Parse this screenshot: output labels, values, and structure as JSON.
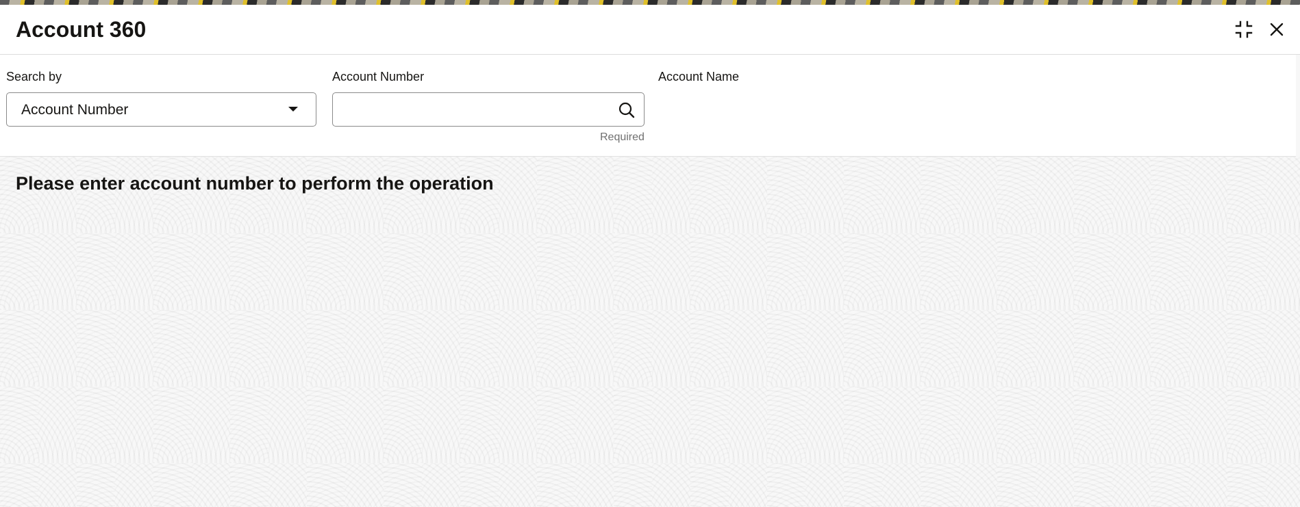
{
  "window": {
    "title": "Account 360"
  },
  "header": {
    "minimize_icon": "collapse-icon",
    "close_icon": "close-icon"
  },
  "form": {
    "search_by": {
      "label": "Search by",
      "value": "Account Number"
    },
    "account_number": {
      "label": "Account Number",
      "value": "",
      "helper": "Required",
      "icon": "search-icon"
    },
    "account_name": {
      "label": "Account Name"
    }
  },
  "message": "Please enter account number to perform the operation",
  "colors": {
    "text": "#161513",
    "border": "#8a8a8a",
    "helper": "#6f6f6f",
    "panel": "#ffffff"
  }
}
